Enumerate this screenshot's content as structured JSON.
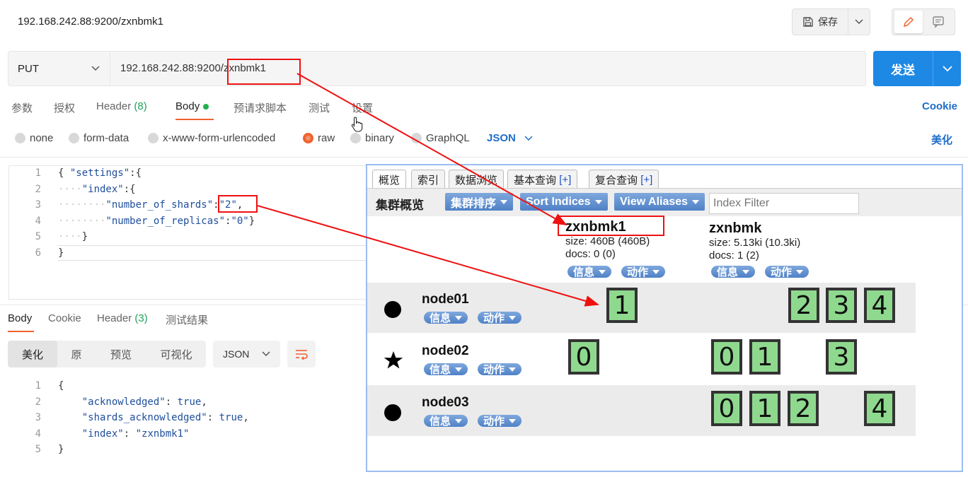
{
  "header": {
    "title": "192.168.242.88:9200/zxnbmk1",
    "save_label": "保存"
  },
  "request": {
    "method": "PUT",
    "url": "192.168.242.88:9200/zxnbmk1",
    "send_label": "发送"
  },
  "req_tabs": {
    "params": "参数",
    "auth": "授权",
    "header": "Header",
    "header_count": "(8)",
    "body": "Body",
    "prescript": "预请求脚本",
    "tests": "测试",
    "settings": "设置",
    "cookie": "Cookie"
  },
  "body_types": {
    "none": "none",
    "form_data": "form-data",
    "urlencoded": "x-www-form-urlencoded",
    "raw": "raw",
    "binary": "binary",
    "graphql": "GraphQL",
    "format": "JSON",
    "beautify": "美化"
  },
  "request_code": {
    "line_numbers": [
      "1",
      "2",
      "3",
      "4",
      "5",
      "6"
    ],
    "l1_brace": "{",
    "l1_key": "\"settings\"",
    "l1_rest": ":{",
    "l2_key": "\"index\"",
    "l2_rest": ":{",
    "l3_key": "\"number_of_shards\"",
    "l3_colon": ":",
    "l3_val": "\"2\"",
    "l3_comma": ",",
    "l4_key": "\"number_of_replicas\"",
    "l4_colon": ":",
    "l4_val": "\"0\"",
    "l4_end": "}",
    "l5": "}",
    "l6": "}"
  },
  "resp_tabs": {
    "body": "Body",
    "cookie": "Cookie",
    "header": "Header",
    "header_count": "(3)",
    "tests": "测试结果"
  },
  "resp_view": {
    "pretty": "美化",
    "raw": "原",
    "preview": "预览",
    "visualize": "可视化",
    "format": "JSON"
  },
  "response_code": {
    "line_numbers": [
      "1",
      "2",
      "3",
      "4",
      "5"
    ],
    "l1": "{",
    "l2_key": "\"acknowledged\"",
    "l2_val": "true",
    "l3_key": "\"shards_acknowledged\"",
    "l3_val": "true",
    "l4_key": "\"index\"",
    "l4_val": "\"zxnbmk1\"",
    "l5": "}"
  },
  "es_head": {
    "tabs": {
      "overview": "概览",
      "indices": "索引",
      "browser": "数据浏览",
      "basic_query": "基本查询",
      "complex_query": "复合查询",
      "plus": "[+]"
    },
    "cluster_title": "集群概览",
    "sort_cluster": "集群排序",
    "sort_indices": "Sort Indices",
    "view_aliases": "View Aliases",
    "filter_placeholder": "Index Filter",
    "info": "信息",
    "action": "动作",
    "indices": [
      {
        "name": "zxnbmk1",
        "size": "size: 460B (460B)",
        "docs": "docs: 0 (0)"
      },
      {
        "name": "zxnbmk",
        "size": "size: 5.13ki (10.3ki)",
        "docs": "docs: 1 (2)"
      }
    ],
    "nodes": [
      {
        "name": "node01",
        "zxnbmk1_shards": [
          "1"
        ],
        "zxnbmk_shards": [
          "2",
          "3",
          "4"
        ]
      },
      {
        "name": "node02",
        "zxnbmk1_shards": [
          "0"
        ],
        "zxnbmk_shards": [
          "0",
          "1",
          "3"
        ]
      },
      {
        "name": "node03",
        "zxnbmk1_shards": [],
        "zxnbmk_shards": [
          "0",
          "1",
          "2",
          "4"
        ]
      }
    ]
  },
  "colors": {
    "accent": "#f0612d",
    "send_blue": "#1e88e5",
    "shard_green": "#8fd98f",
    "annotation_red": "#ee1111"
  }
}
